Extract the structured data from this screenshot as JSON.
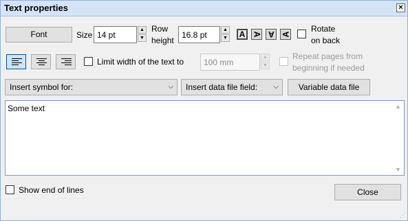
{
  "window": {
    "title": "Text properties",
    "close_glyph": "×"
  },
  "toolbar": {
    "font_label": "Font",
    "size_label": "Size",
    "size_value": "14 pt",
    "row_height_label_1": "Row",
    "row_height_label_2": "height",
    "row_height_value": "16.8 pt",
    "rotate_buttons": [
      "A",
      "A",
      "A",
      "A"
    ],
    "rotate_label_1": "Rotate",
    "rotate_label_2": "on back",
    "rotate_on_back_checked": false
  },
  "row2": {
    "limit_width_label": "Limit width of the text to",
    "limit_width_checked": false,
    "limit_width_value": "100 mm",
    "repeat_pages_label_1": "Repeat pages from",
    "repeat_pages_label_2": "beginning if needed",
    "repeat_pages_checked": false,
    "alignment": [
      "align-left",
      "align-center",
      "align-right"
    ],
    "selected_alignment": "align-left"
  },
  "row3": {
    "insert_symbol_label": "Insert symbol for:",
    "insert_field_label": "Insert data file field:",
    "variable_data_label": "Variable data file"
  },
  "editor": {
    "text": "Some text"
  },
  "footer": {
    "show_end_label": "Show end of lines",
    "show_end_checked": false,
    "close_label": "Close"
  }
}
